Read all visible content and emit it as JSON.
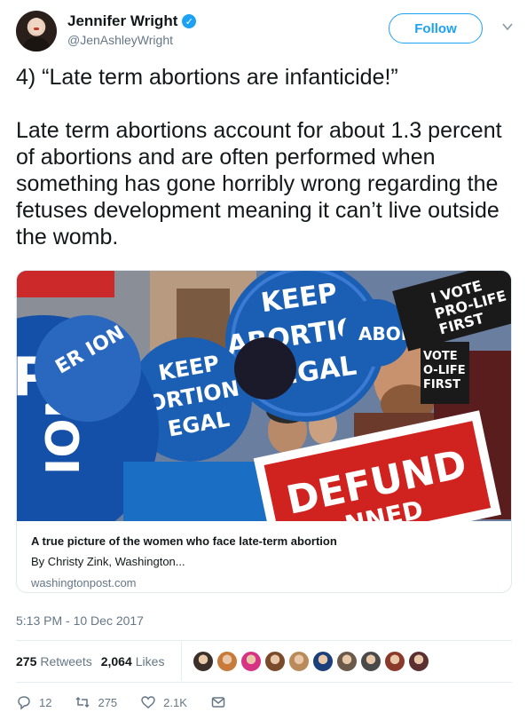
{
  "author": {
    "name": "Jennifer Wright",
    "handle": "@JenAshleyWright"
  },
  "follow_label": "Follow",
  "tweet_text": "4) “Late term abortions are infanticide!”\n\nLate term abortions account for about 1.3 percent of abortions and are often performed when something has gone horribly wrong regarding the fetuses development meaning it can’t live outside the womb.",
  "card": {
    "title": "A true picture of the women who face late-term abortion",
    "description": "By Christy Zink, Washington...",
    "domain": "washingtonpost.com",
    "image_signs": {
      "keep_top": "KEEP",
      "abortion_top": "ABORTION",
      "legal_top": "LEGAL",
      "keep_left": "KEEP",
      "abortion_left": "ORTION",
      "legal_left": "EGAL",
      "vote_right": "I VOTE\nPRO-LIFE\nFIRST",
      "vote_mid": "VOTE\nO-LIFE\nFIRST",
      "defund": "DEFUND",
      "defund_sub": "NNED",
      "pion_left": "P\nION",
      "er_left": "ER\nION",
      "abor_mid": "ABOR"
    }
  },
  "timestamp": "5:13 PM - 10 Dec 2017",
  "stats": {
    "retweets_count": "275",
    "retweets_label": "Retweets",
    "likes_count": "2,064",
    "likes_label": "Likes"
  },
  "liker_colors": [
    "#3b2f2a",
    "#c87a3a",
    "#d63384",
    "#7a4b2a",
    "#b98a5a",
    "#1b3f7a",
    "#6b5a4a",
    "#4a4a4a",
    "#8a3a2a",
    "#5a3030"
  ],
  "actions": {
    "replies": "12",
    "retweets": "275",
    "likes": "2.1K"
  },
  "colors": {
    "brand": "#1da1f2",
    "muted": "#657786"
  }
}
